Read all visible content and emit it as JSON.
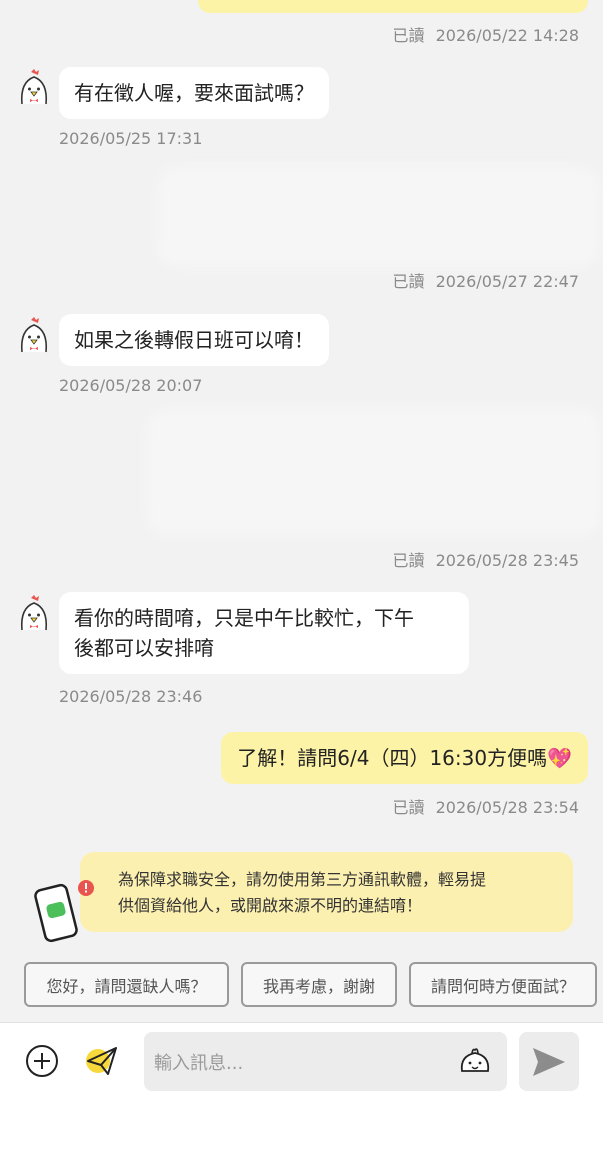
{
  "messages": [
    {
      "type": "out",
      "read_label": "已讀",
      "time": "2026/05/22 14:28"
    },
    {
      "type": "in",
      "text": "有在徵人喔，要來面試嗎？",
      "time": "2026/05/25 17:31"
    },
    {
      "type": "out",
      "read_label": "已讀",
      "time": "2026/05/27 22:47"
    },
    {
      "type": "in",
      "text": "如果之後轉假日班可以唷！",
      "time": "2026/05/28 20:07"
    },
    {
      "type": "out",
      "read_label": "已讀",
      "time": "2026/05/28 23:45"
    },
    {
      "type": "in",
      "text_line1": "看你的時間唷，只是中午比較忙，下午",
      "text_line2": "後都可以安排唷",
      "time": "2026/05/28 23:46"
    },
    {
      "type": "out",
      "text": "了解！請問6/4（四）16:30方便嗎",
      "emoji": "💖",
      "read_label": "已讀",
      "time": "2026/05/28 23:54"
    }
  ],
  "notice": {
    "line1": "為保障求職安全，請勿使用第三方通訊軟體，輕易提",
    "line2": "供個資給他人，或開啟來源不明的連結唷！"
  },
  "quick_replies": [
    "您好，請問還缺人嗎？",
    "我再考慮，謝謝",
    "請問何時方便面試？"
  ],
  "composer": {
    "placeholder": "輸入訊息...",
    "icons": [
      "plus-icon",
      "paper-plane-icon",
      "sticker-icon",
      "send-icon"
    ]
  },
  "colors": {
    "outgoing_bubble": "#fdf3a7",
    "incoming_bubble": "#ffffff",
    "background": "#f2f2f2",
    "notice_bg": "#fcf0b0",
    "accent_yellow": "#f7d83a",
    "alert_red": "#e8554e",
    "phone_green": "#4cbf5a"
  }
}
